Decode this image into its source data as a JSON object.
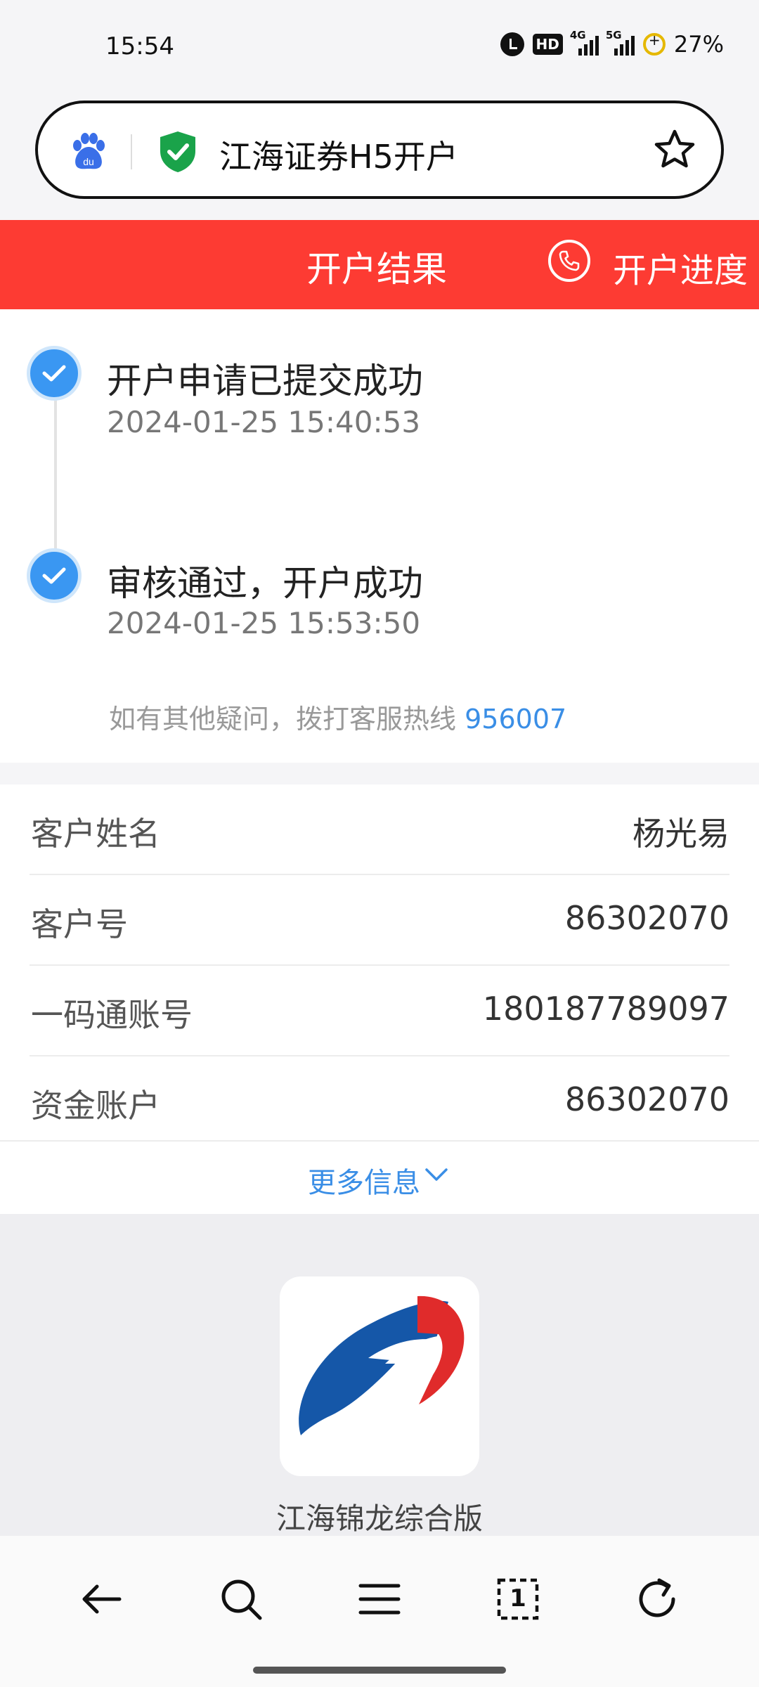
{
  "status_bar": {
    "time": "15:54",
    "hd_label": "HD",
    "signal1_label": "4G",
    "signal2_label": "5G",
    "battery": "27%"
  },
  "address_bar": {
    "title": "江海证券H5开户"
  },
  "header": {
    "title": "开户结果",
    "progress_link": "开户进度"
  },
  "timeline": [
    {
      "title": "开户申请已提交成功",
      "time": "2024-01-25 15:40:53"
    },
    {
      "title": "审核通过，开户成功",
      "time": "2024-01-25 15:53:50"
    }
  ],
  "hotline": {
    "text": "如有其他疑问，拨打客服热线",
    "number": "956007"
  },
  "info": {
    "rows": [
      {
        "label": "客户姓名",
        "value": "杨光易"
      },
      {
        "label": "客户号",
        "value": "86302070"
      },
      {
        "label": "一码通账号",
        "value": "180187789097"
      },
      {
        "label": "资金账户",
        "value": "86302070"
      }
    ],
    "more_label": "更多信息"
  },
  "promo": {
    "app_name": "江海锦龙综合版"
  },
  "bottom_nav": {
    "tab_count": "1"
  },
  "colors": {
    "header_red": "#fd3b33",
    "accent_blue": "#3a97f2",
    "link_blue": "#3a8ee6",
    "shield_green": "#1aa34a"
  }
}
